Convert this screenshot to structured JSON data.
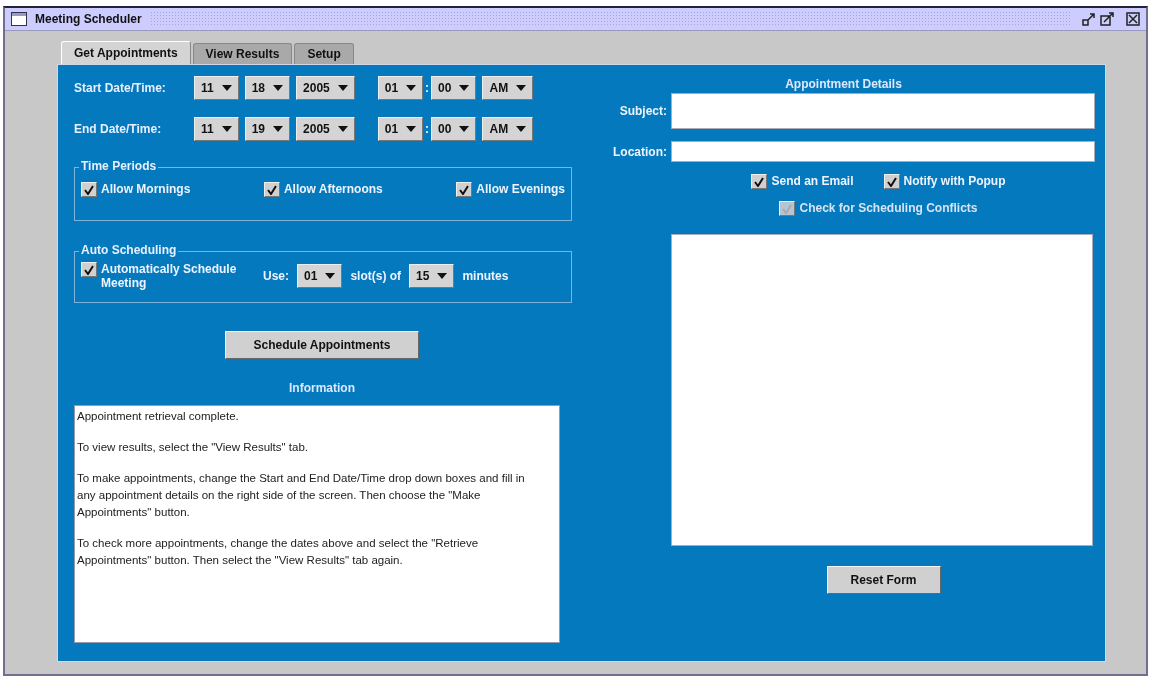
{
  "window": {
    "title": "Meeting Scheduler"
  },
  "tabs": [
    {
      "label": "Get Appointments",
      "selected": true
    },
    {
      "label": "View Results",
      "selected": false
    },
    {
      "label": "Setup",
      "selected": false
    }
  ],
  "date_times": [
    {
      "label": "Start Date/Time:",
      "date": [
        "11",
        "18",
        "2005"
      ],
      "time": [
        "01",
        "00"
      ],
      "separator": ":",
      "period": "AM"
    },
    {
      "label": "End Date/Time:",
      "date": [
        "11",
        "19",
        "2005"
      ],
      "time": [
        "01",
        "00"
      ],
      "separator": ":",
      "period": "AM"
    }
  ],
  "time_periods": {
    "title": "Time Periods",
    "options": [
      {
        "label": "Allow Mornings",
        "checked": true
      },
      {
        "label": "Allow Afternoons",
        "checked": true
      },
      {
        "label": "Allow Evenings",
        "checked": true
      }
    ]
  },
  "auto_scheduling": {
    "title": "Auto Scheduling",
    "checkbox": {
      "label": "Automatically Schedule Meeting",
      "checked": true
    },
    "use_label": "Use:",
    "slots": "01",
    "slots_label": "slot(s) of",
    "minutes": "15",
    "minutes_label": "minutes"
  },
  "schedule_button": "Schedule Appointments",
  "information": {
    "title": "Information",
    "paragraphs": [
      "Appointment retrieval complete.",
      "To view results, select the \"View Results\" tab.",
      "To make appointments, change the Start and End Date/Time drop down boxes and fill in any appointment details on the right side of the screen. Then choose the \"Make Appointments\" button.",
      "To check more appointments, change the dates above and select the \"Retrieve Appointments\" button. Then select the \"View Results\" tab again."
    ]
  },
  "appointment_details": {
    "title": "Appointment Details",
    "subject_label": "Subject:",
    "location_label": "Location:",
    "options": [
      {
        "label": "Send an Email",
        "checked": true,
        "disabled": false
      },
      {
        "label": "Notify with Popup",
        "checked": true,
        "disabled": false
      },
      {
        "label": "Check for Scheduling Conflicts",
        "checked": true,
        "disabled": true
      }
    ]
  },
  "reset_button": "Reset Form"
}
